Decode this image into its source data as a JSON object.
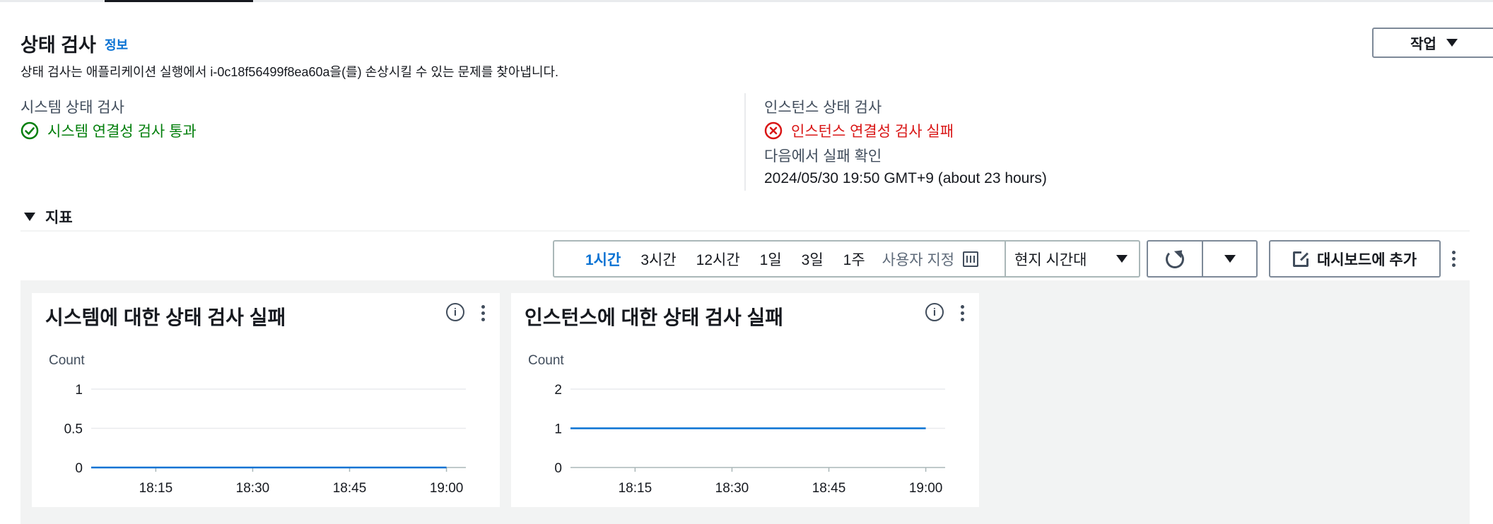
{
  "header": {
    "title": "상태 검사",
    "info_link": "정보",
    "description": "상태 검사는 애플리케이션 실행에서 i-0c18f56499f8ea60a을(를) 손상시킬 수 있는 문제를 찾아냅니다.",
    "action_label": "작업"
  },
  "system_check": {
    "label": "시스템 상태 검사",
    "status": "시스템 연결성 검사 통과",
    "status_color": "#037f0c"
  },
  "instance_check": {
    "label": "인스턴스 상태 검사",
    "status": "인스턴스 연결성 검사 실패",
    "status_color": "#d91515",
    "failure_label": "다음에서 실패 확인",
    "failure_time": "2024/05/30 19:50 GMT+9 (about 23 hours)"
  },
  "metrics": {
    "header": "지표",
    "ranges": [
      "1시간",
      "3시간",
      "12시간",
      "1일",
      "3일",
      "1주"
    ],
    "active_range": "1시간",
    "custom_label": "사용자 지정",
    "timezone": "현지 시간대",
    "dashboard_label": "대시보드에 추가"
  },
  "chart_data": [
    {
      "type": "line",
      "title": "시스템에 대한 상태 검사 실패",
      "ylabel": "Count",
      "ylim": [
        0,
        1
      ],
      "yticks": [
        "1",
        "0.5",
        "0"
      ],
      "xticks": [
        "18:15",
        "18:30",
        "18:45",
        "19:00"
      ],
      "series": [
        {
          "x": [
            "18:05",
            "19:00"
          ],
          "values": [
            0,
            0
          ],
          "color": "#0972d3"
        }
      ]
    },
    {
      "type": "line",
      "title": "인스턴스에 대한 상태 검사 실패",
      "ylabel": "Count",
      "ylim": [
        0,
        2
      ],
      "yticks": [
        "2",
        "1",
        "0"
      ],
      "xticks": [
        "18:15",
        "18:30",
        "18:45",
        "19:00"
      ],
      "series": [
        {
          "x": [
            "18:05",
            "19:00"
          ],
          "values": [
            1,
            1
          ],
          "color": "#0972d3"
        }
      ]
    }
  ]
}
